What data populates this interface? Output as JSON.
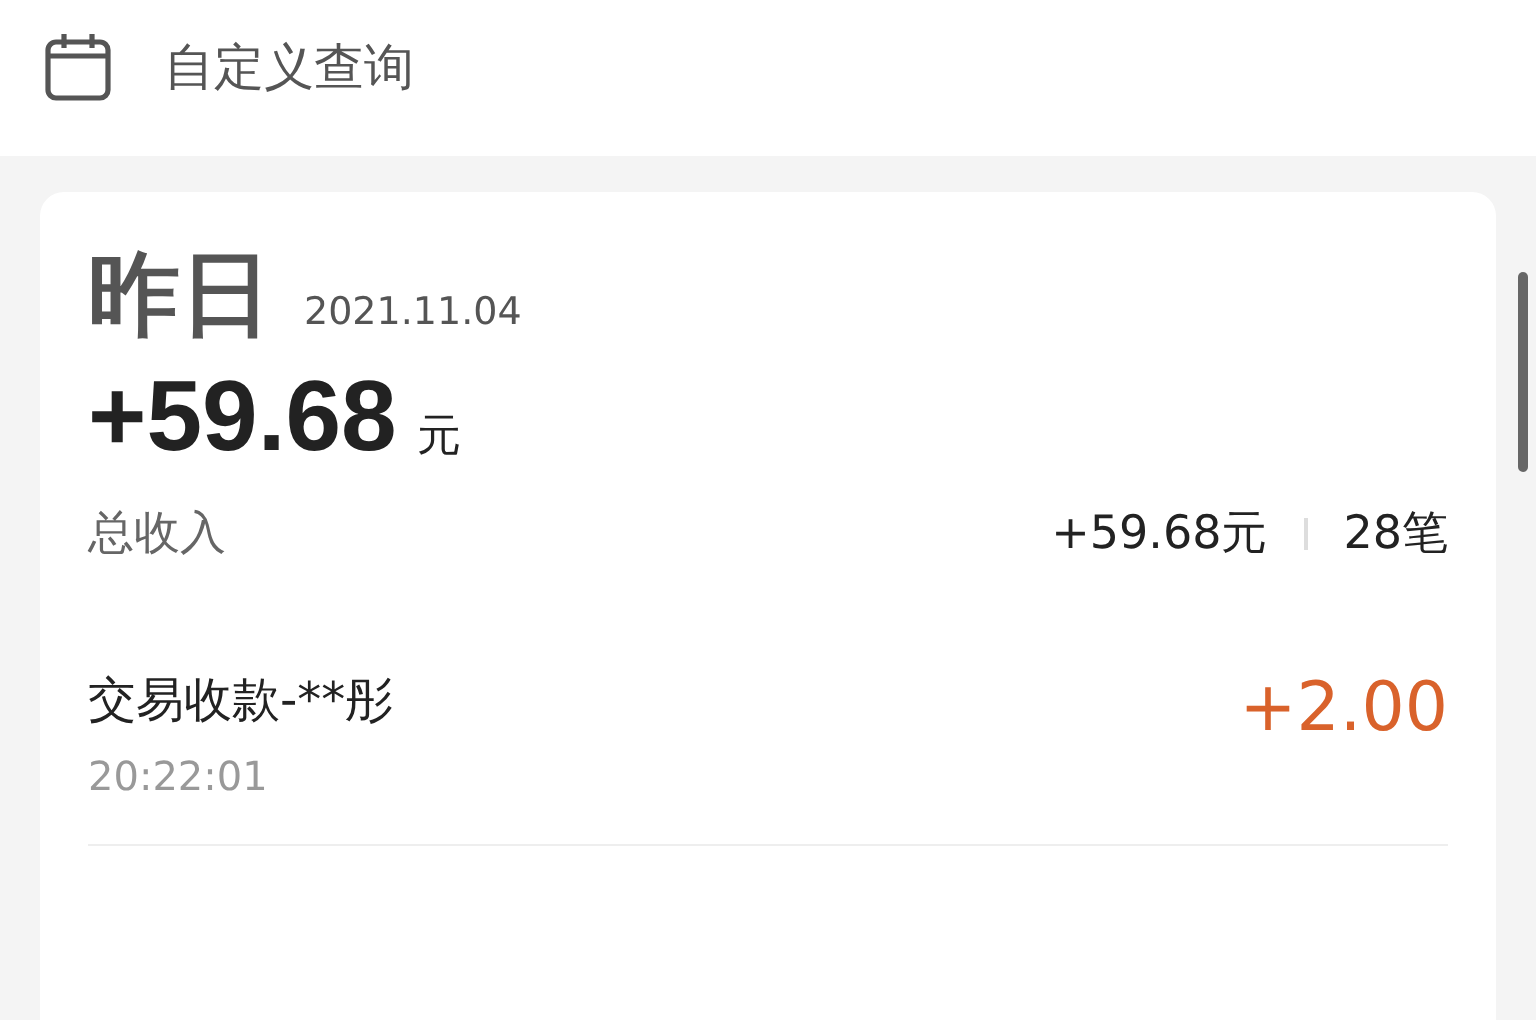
{
  "header": {
    "title": "自定义查询"
  },
  "summary": {
    "day": "昨日",
    "date": "2021.11.04",
    "amount": "+59.68",
    "unit": "元",
    "income_label": "总收入",
    "income_amount": "+59.68元",
    "count": "28笔"
  },
  "transactions": [
    {
      "name": "交易收款-**彤",
      "time": "20:22:01",
      "amount": "+2.00",
      "kind": "income"
    }
  ]
}
